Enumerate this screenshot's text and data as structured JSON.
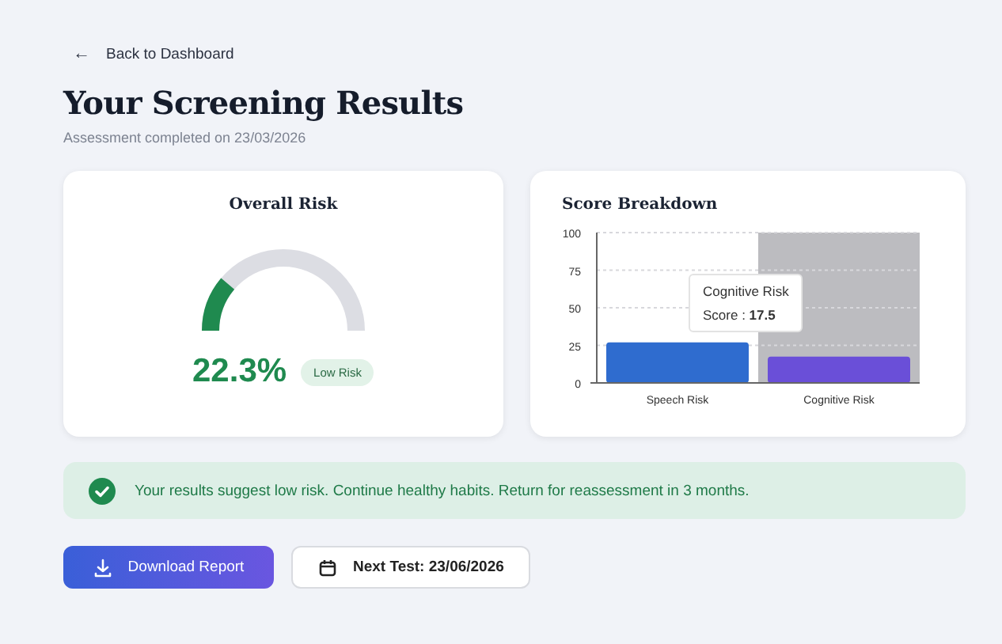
{
  "back_link": {
    "icon": "←",
    "label": "Back to Dashboard"
  },
  "title": "Your Screening Results",
  "subtitle": "Assessment completed on 23/03/2026",
  "risk_card": {
    "title": "Overall Risk",
    "value": "22.3%",
    "badge": "Low Risk"
  },
  "breakdown_card": {
    "title": "Score Breakdown",
    "bars": [
      {
        "color": "#2f6ccf",
        "hovered": false
      },
      {
        "color": "#6a4fd8",
        "hovered": true
      }
    ],
    "tooltip": {
      "title": "Cognitive Risk",
      "label": "Score : ",
      "value": "17.5"
    },
    "chart_data": {
      "type": "bar",
      "categories": [
        "Speech Risk",
        "Cognitive Risk"
      ],
      "grid": true,
      "ylim": [
        0,
        100
      ],
      "yticks": [
        0,
        25,
        50,
        75,
        100
      ],
      "values": [
        27,
        17.5
      ]
    }
  },
  "banner": {
    "text": "Your results suggest low risk. Continue healthy habits. Return for reassessment in 3 months."
  },
  "buttons": [
    {
      "kind": "primary",
      "label": "Download Report"
    },
    {
      "kind": "secondary",
      "label": "Next Test: 23/06/2026"
    }
  ]
}
